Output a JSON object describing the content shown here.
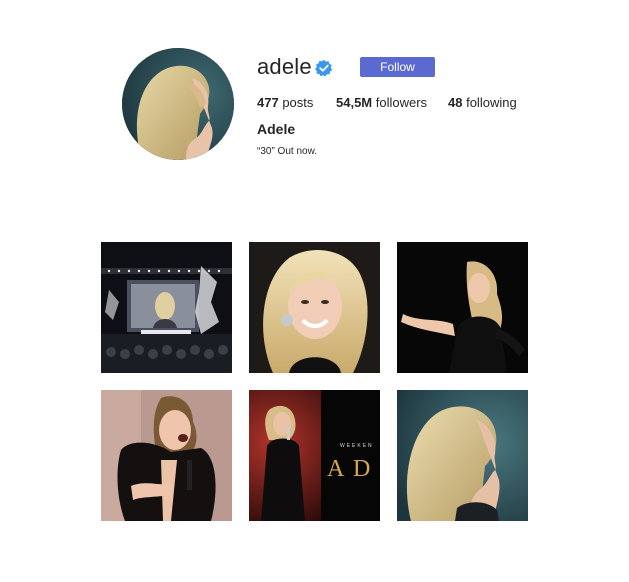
{
  "profile": {
    "username": "adele",
    "follow_label": "Follow",
    "posts_count": "477",
    "posts_label": "posts",
    "followers_count": "54,5M",
    "followers_label": "followers",
    "following_count": "48",
    "following_label": "following",
    "full_name": "Adele",
    "bio": "“30” Out now.",
    "verified_color": "#3897f0",
    "follow_color": "#5b6ad0"
  },
  "grid": {
    "posts": [
      {
        "icon": "concert-stage-photo"
      },
      {
        "icon": "smiling-portrait-photo"
      },
      {
        "icon": "performing-on-stage-photo"
      },
      {
        "icon": "singing-laughing-photo"
      },
      {
        "icon": "weekend-adele-photo",
        "overlay_text": "WEEKEN",
        "overlay_big": "A D E"
      },
      {
        "icon": "profile-portrait-photo"
      }
    ]
  }
}
